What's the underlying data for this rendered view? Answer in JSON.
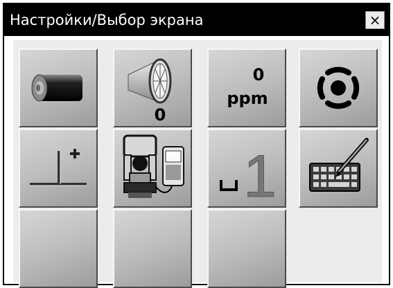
{
  "window": {
    "title": "Настройки/Выбор экрана",
    "close_glyph": "×"
  },
  "buttons": [
    {
      "name": "battery-button",
      "icon": "battery-icon"
    },
    {
      "name": "prism-constant-button",
      "icon": "prism-icon",
      "value": "0"
    },
    {
      "name": "ppm-button",
      "icon": "ppm-icon",
      "value": "0",
      "unit": "ppm"
    },
    {
      "name": "laser-pointer-button",
      "icon": "target-icon"
    },
    {
      "name": "height-offset-button",
      "icon": "height-offset-icon"
    },
    {
      "name": "instrument-controller-button",
      "icon": "total-station-icon"
    },
    {
      "name": "step-one-button",
      "icon": "step-icon",
      "value": "1"
    },
    {
      "name": "keyboard-pen-button",
      "icon": "keyboard-pen-icon"
    },
    {
      "name": "empty-button-1"
    },
    {
      "name": "empty-button-2"
    },
    {
      "name": "empty-button-3"
    }
  ]
}
